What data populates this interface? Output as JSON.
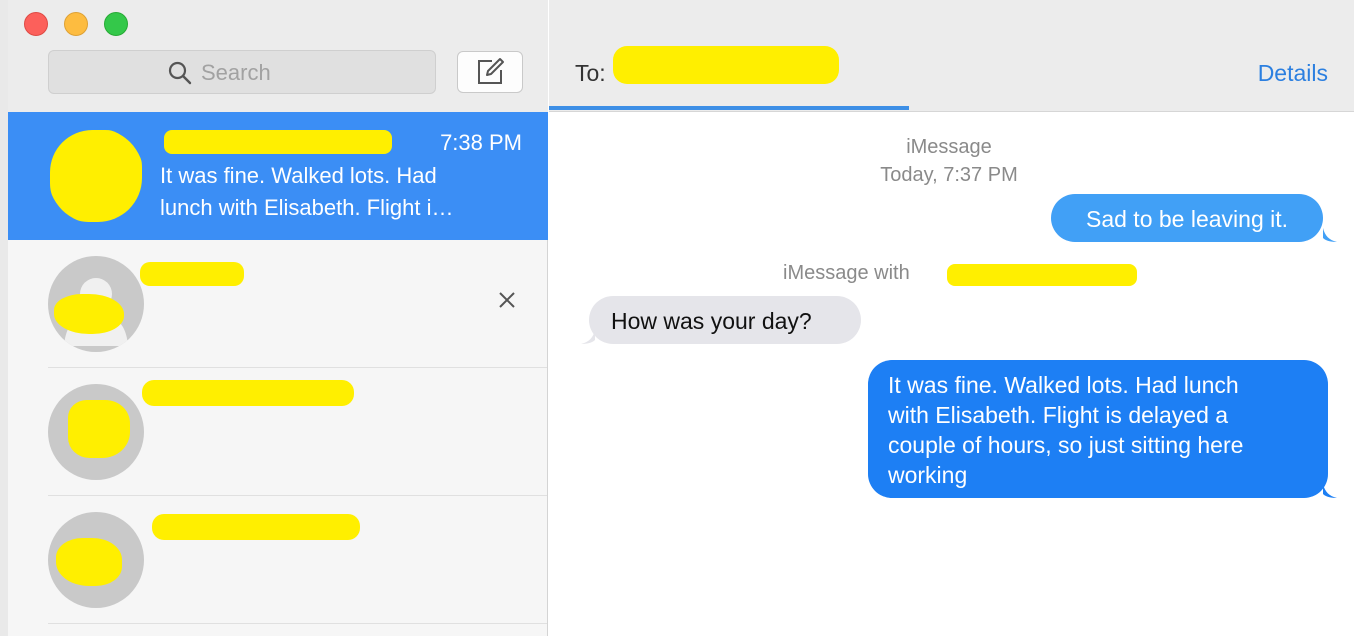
{
  "window": {
    "traffic_lights": {
      "close": "#fc605b",
      "minimize": "#fdbc40",
      "zoom": "#34c84a"
    }
  },
  "sidebar": {
    "search": {
      "placeholder": "Search",
      "icon": "search-icon"
    },
    "compose": {
      "icon": "compose-icon"
    },
    "conversations": [
      {
        "time": "7:38 PM",
        "preview_line1": "It was fine.  Walked lots.  Had",
        "preview_line2": "lunch with Elisabeth.  Flight i…",
        "selected": true
      },
      {
        "selected": false,
        "has_close": true
      },
      {
        "selected": false
      },
      {
        "selected": false
      }
    ],
    "selection_color": "#3b8ef5"
  },
  "chat": {
    "to_label": "To:",
    "details_label": "Details",
    "service_label": "iMessage",
    "timestamp": "Today, 7:37 PM",
    "messages": [
      {
        "direction": "sent",
        "text": "Sad to be leaving it."
      },
      {
        "direction": "meta",
        "text": "iMessage with"
      },
      {
        "direction": "received",
        "text": "How was your day?"
      },
      {
        "direction": "sent",
        "lines": [
          "It was fine.  Walked lots.  Had lunch",
          "with Elisabeth.  Flight is delayed a",
          "couple of hours, so just sitting here",
          "working"
        ]
      }
    ],
    "colors": {
      "sent": "#41a0f6",
      "sent_latest": "#1d7ff4",
      "received": "#e5e5ea",
      "link": "#2b7fe0"
    }
  }
}
